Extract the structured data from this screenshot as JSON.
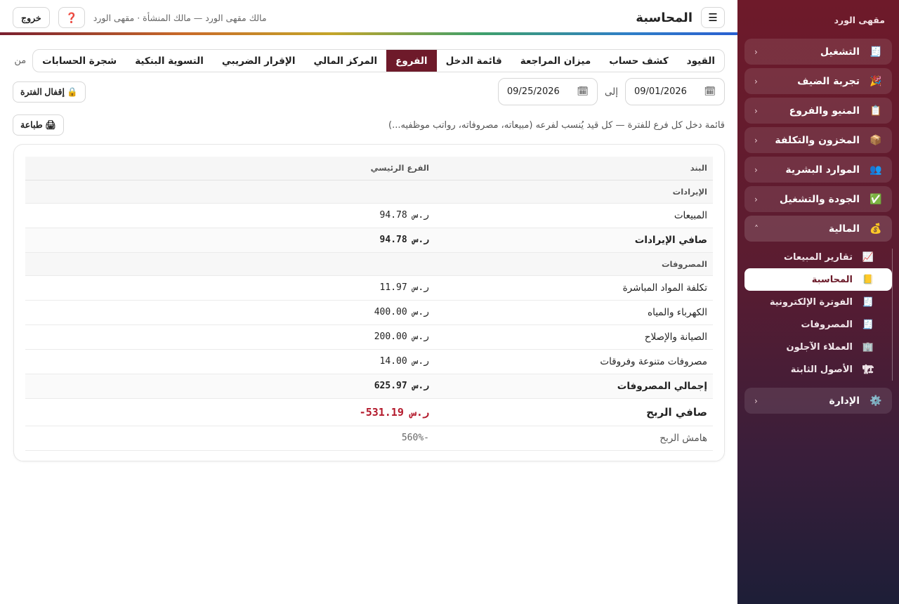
{
  "sidebar": {
    "brand": "مقهى الورد",
    "groups": [
      {
        "label": "التشغيل",
        "icon": "🧾"
      },
      {
        "label": "تجربة الضيف",
        "icon": "🎉"
      },
      {
        "label": "المنيو والفروع",
        "icon": "📋"
      },
      {
        "label": "المخزون والتكلفة",
        "icon": "📦"
      },
      {
        "label": "الموارد البشرية",
        "icon": "👥"
      },
      {
        "label": "الجودة والتشغيل",
        "icon": "✅"
      },
      {
        "label": "المالية",
        "icon": "💰"
      },
      {
        "label": "الإدارة",
        "icon": "⚙️"
      }
    ],
    "finance_items": [
      {
        "label": "تقارير المبيعات",
        "icon": "📈"
      },
      {
        "label": "المحاسبة",
        "icon": "📒"
      },
      {
        "label": "الفوترة الإلكترونية",
        "icon": "🧾"
      },
      {
        "label": "المصروفات",
        "icon": "🧾"
      },
      {
        "label": "العملاء الآجلون",
        "icon": "🏢"
      },
      {
        "label": "الأصول الثابتة",
        "icon": "🏗"
      }
    ],
    "chevron_closed": "‹",
    "chevron_open": "˄"
  },
  "topbar": {
    "menu_icon": "☰",
    "title": "المحاسبة",
    "user_info": "مالك مقهى الورد — مالك المنشأة · مقهى الورد",
    "help_icon": "❓",
    "logout_label": "خروج"
  },
  "tabs": {
    "items": [
      "القيود",
      "كشف حساب",
      "ميزان المراجعة",
      "قائمة الدخل",
      "الفروع",
      "المركز المالي",
      "الإقرار الضريبي",
      "التسوية البنكية",
      "شجرة الحسابات"
    ],
    "active": "الفروع",
    "more_label": "من"
  },
  "period": {
    "from": "09/01/2026",
    "to_label": "إلى",
    "to": "09/25/2026",
    "calendar_icon": "🗓",
    "lock_label": "🔒 إقفال الفترة"
  },
  "description": "قائمة دخل كل فرع للفترة — كل قيد يُنسب لفرعه (مبيعاته، مصروفاته، رواتب موظفيه...)",
  "print_label": "🖨 طباعة",
  "report": {
    "col_item": "البند",
    "col_branch": "الفرع الرئيسي",
    "revenue_header": "الإيرادات",
    "sales_label": "المبيعات",
    "sales_amount": "ر.س 94.78",
    "net_revenue_label": "صافي الإيرادات",
    "net_revenue_amount": "ر.س 94.78",
    "expenses_header": "المصروفات",
    "expense_rows": [
      {
        "label": "تكلفة المواد المباشرة",
        "amount": "ر.س 11.97"
      },
      {
        "label": "الكهرباء والمياه",
        "amount": "ر.س 400.00"
      },
      {
        "label": "الصيانة والإصلاح",
        "amount": "ر.س 200.00"
      },
      {
        "label": "مصروفات متنوعة وفروقات",
        "amount": "ر.س 14.00"
      }
    ],
    "total_expenses_label": "إجمالي المصروفات",
    "total_expenses_amount": "ر.س 625.97",
    "net_profit_label": "صافي الربح",
    "net_profit_amount": "ر.س 531.19-",
    "margin_label": "هامش الربح",
    "margin_value": "-560%"
  },
  "colors": {
    "brand": "#6e1a2a",
    "negative": "#b3192b"
  }
}
